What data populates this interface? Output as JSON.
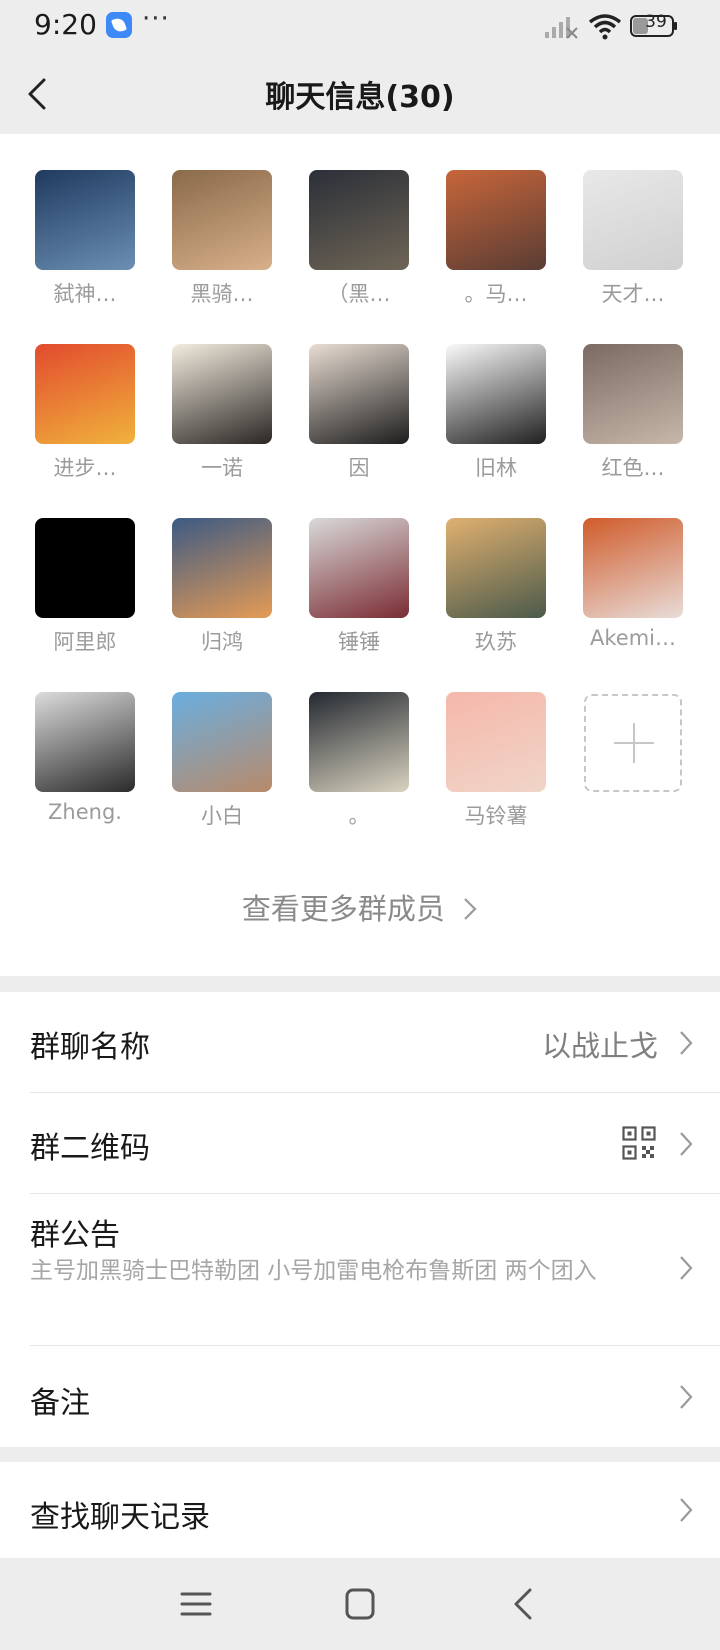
{
  "status_bar": {
    "time": "9:20",
    "more": "···",
    "battery": "39"
  },
  "header": {
    "title": "聊天信息(30)"
  },
  "members": [
    {
      "name": "弑神…",
      "colors": [
        "#1f3a5f",
        "#6b8fb3"
      ]
    },
    {
      "name": "黑骑…",
      "colors": [
        "#8a6a4a",
        "#d8b08a"
      ]
    },
    {
      "name": "（黑…",
      "colors": [
        "#2b2f38",
        "#6e6556"
      ]
    },
    {
      "name": "。马…",
      "colors": [
        "#c7663a",
        "#5a3c34"
      ]
    },
    {
      "name": "天才…",
      "colors": [
        "#e8e8e8",
        "#d0d0d0"
      ]
    },
    {
      "name": "进步…",
      "colors": [
        "#e24b2e",
        "#f0b23c"
      ]
    },
    {
      "name": "一诺",
      "colors": [
        "#f3ecdf",
        "#2a2724"
      ]
    },
    {
      "name": "因",
      "colors": [
        "#e9ddd3",
        "#1d1d1d"
      ]
    },
    {
      "name": "旧林",
      "colors": [
        "#fafafa",
        "#202020"
      ]
    },
    {
      "name": "红色…",
      "colors": [
        "#7b6a62",
        "#c7b7aa"
      ]
    },
    {
      "name": "阿里郎",
      "colors": [
        "#000000",
        "#000000"
      ]
    },
    {
      "name": "归鸿",
      "colors": [
        "#3c5a84",
        "#e59b55"
      ]
    },
    {
      "name": "锤锤",
      "colors": [
        "#d9d9d9",
        "#7a2c33"
      ]
    },
    {
      "name": "玖苏",
      "colors": [
        "#e0b070",
        "#4b5a4a"
      ]
    },
    {
      "name": "Akemi…",
      "colors": [
        "#d05b2a",
        "#e8dcd8"
      ]
    },
    {
      "name": "Zheng.",
      "colors": [
        "#dcdcdc",
        "#2a2a2a"
      ]
    },
    {
      "name": "小白",
      "colors": [
        "#6aaee0",
        "#b88a6a"
      ]
    },
    {
      "name": "。",
      "colors": [
        "#232830",
        "#d9d3c0"
      ]
    },
    {
      "name": "马铃薯",
      "colors": [
        "#f5b7aa",
        "#f0d5c8"
      ]
    }
  ],
  "see_more": "查看更多群成员",
  "rows": {
    "group_name": {
      "label": "群聊名称",
      "value": "以战止戈"
    },
    "qr_code": {
      "label": "群二维码"
    },
    "notice": {
      "label": "群公告",
      "text": "主号加黑骑士巴特勒团  小号加雷电枪布鲁斯团 两个团入"
    },
    "remark": {
      "label": "备注"
    },
    "search": {
      "label": "查找聊天记录"
    }
  },
  "icons": {
    "back": "back-chevron-icon",
    "chevron": "chevron-right-icon",
    "qr": "qr-code-icon",
    "add": "plus-icon",
    "nav": [
      "menu-icon",
      "home-square-icon",
      "back-icon"
    ]
  }
}
